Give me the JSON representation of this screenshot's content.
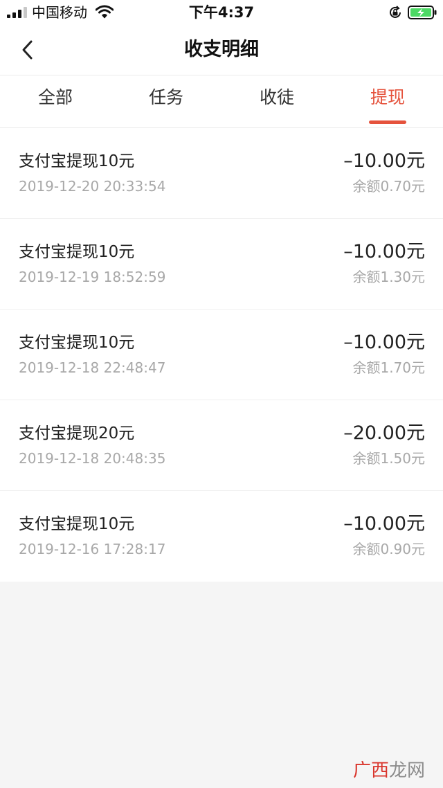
{
  "status_bar": {
    "carrier": "中国移动",
    "time": "下午4:37",
    "icons": [
      "signal-icon",
      "wifi-icon",
      "orientation-lock-icon",
      "battery-charging-icon"
    ]
  },
  "header": {
    "title": "收支明细",
    "back_icon": "chevron-left-icon"
  },
  "tabs": [
    {
      "label": "全部",
      "active": false
    },
    {
      "label": "任务",
      "active": false
    },
    {
      "label": "收徒",
      "active": false
    },
    {
      "label": "提现",
      "active": true
    }
  ],
  "records": [
    {
      "desc": "支付宝提现10元",
      "time": "2019-12-20 20:33:54",
      "amount": "–10.00元",
      "balance": "余额0.70元"
    },
    {
      "desc": "支付宝提现10元",
      "time": "2019-12-19 18:52:59",
      "amount": "–10.00元",
      "balance": "余额1.30元"
    },
    {
      "desc": "支付宝提现10元",
      "time": "2019-12-18 22:48:47",
      "amount": "–10.00元",
      "balance": "余额1.70元"
    },
    {
      "desc": "支付宝提现20元",
      "time": "2019-12-18 20:48:35",
      "amount": "–20.00元",
      "balance": "余额1.50元"
    },
    {
      "desc": "支付宝提现10元",
      "time": "2019-12-16 17:28:17",
      "amount": "–10.00元",
      "balance": "余额0.90元"
    }
  ],
  "watermark": {
    "part1": "广西",
    "part2": "龙网"
  },
  "colors": {
    "accent": "#e5533d",
    "battery": "#4cd964",
    "watermark_red": "#d9342b",
    "watermark_gray": "#8c8c8c"
  }
}
